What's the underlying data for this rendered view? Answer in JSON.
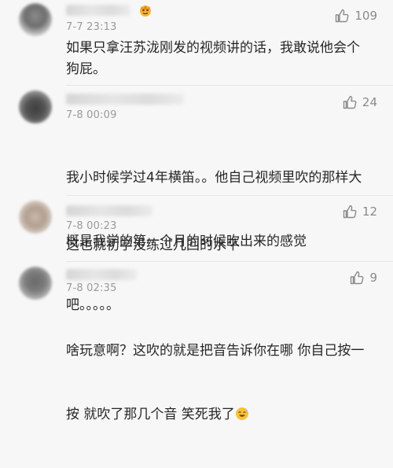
{
  "comments": [
    {
      "time": "7-7 23:13",
      "likes": "109",
      "badge_icon": "crown-avatar-badge-icon",
      "text": "如果只拿汪苏泷刚发的视频讲的话，我敢说他会个狗屁。"
    },
    {
      "time": "7-8 00:09",
      "likes": "24",
      "text_line1": "我小时候学过4年横笛。。他自己视频里吹的那样大",
      "text_line2": "概是我学的第一个月的时候吹出来的感觉",
      "text_line3": "吧。。。。。"
    },
    {
      "time": "7-8 00:23",
      "likes": "12",
      "text": "这也就初学没练过几回的水平"
    },
    {
      "time": "7-8 02:35",
      "likes": "9",
      "text_line1": "啥玩意啊？这吹的就是把音告诉你在哪 你自己按一",
      "text_line2": "按 就吹了那几个音 笑死我了",
      "emoji_icon": "laughing-sweat-emoji-icon"
    }
  ],
  "colors": {
    "meta": "#9a9a9a",
    "text": "#262626",
    "background": "#f7f7f7"
  }
}
